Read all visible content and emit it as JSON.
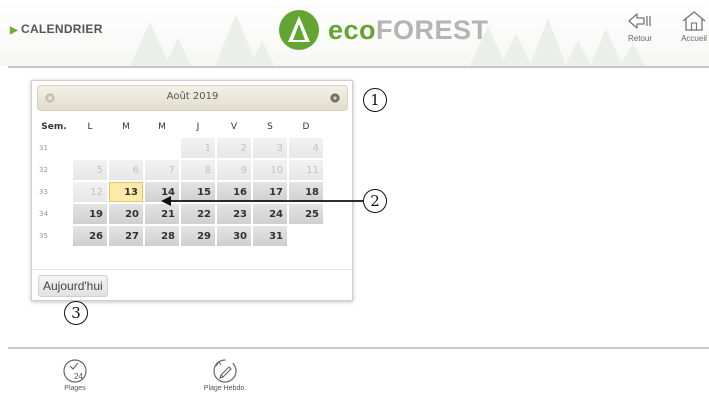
{
  "header": {
    "breadcrumb": "CALENDRIER",
    "brand_eco": "eco",
    "brand_forest": "FOREST",
    "retour_label": "Retour",
    "accueil_label": "Accueil"
  },
  "calendar": {
    "month_title": "Août 2019",
    "week_header": "Sem.",
    "days": [
      "L",
      "M",
      "M",
      "J",
      "V",
      "S",
      "D"
    ],
    "weeks": [
      {
        "num": "31",
        "cells": [
          "",
          "",
          "",
          "1",
          "2",
          "3",
          "4"
        ]
      },
      {
        "num": "32",
        "cells": [
          "5",
          "6",
          "7",
          "8",
          "9",
          "10",
          "11"
        ]
      },
      {
        "num": "33",
        "cells": [
          "12",
          "13",
          "14",
          "15",
          "16",
          "17",
          "18"
        ]
      },
      {
        "num": "34",
        "cells": [
          "19",
          "20",
          "21",
          "22",
          "23",
          "24",
          "25"
        ]
      },
      {
        "num": "35",
        "cells": [
          "26",
          "27",
          "28",
          "29",
          "30",
          "31",
          ""
        ]
      }
    ],
    "today": "13",
    "today_button": "Aujourd'hui"
  },
  "annotations": {
    "c1": "1",
    "c2": "2",
    "c3": "3"
  },
  "toolbar": {
    "plages_label": "Plages",
    "plages_badge": "24",
    "hebdo_label": "Plage Hebdo."
  },
  "colors": {
    "brand_green": "#63a532",
    "today_bg": "#fbeaa9",
    "header_bg": "#f6f7f5"
  }
}
